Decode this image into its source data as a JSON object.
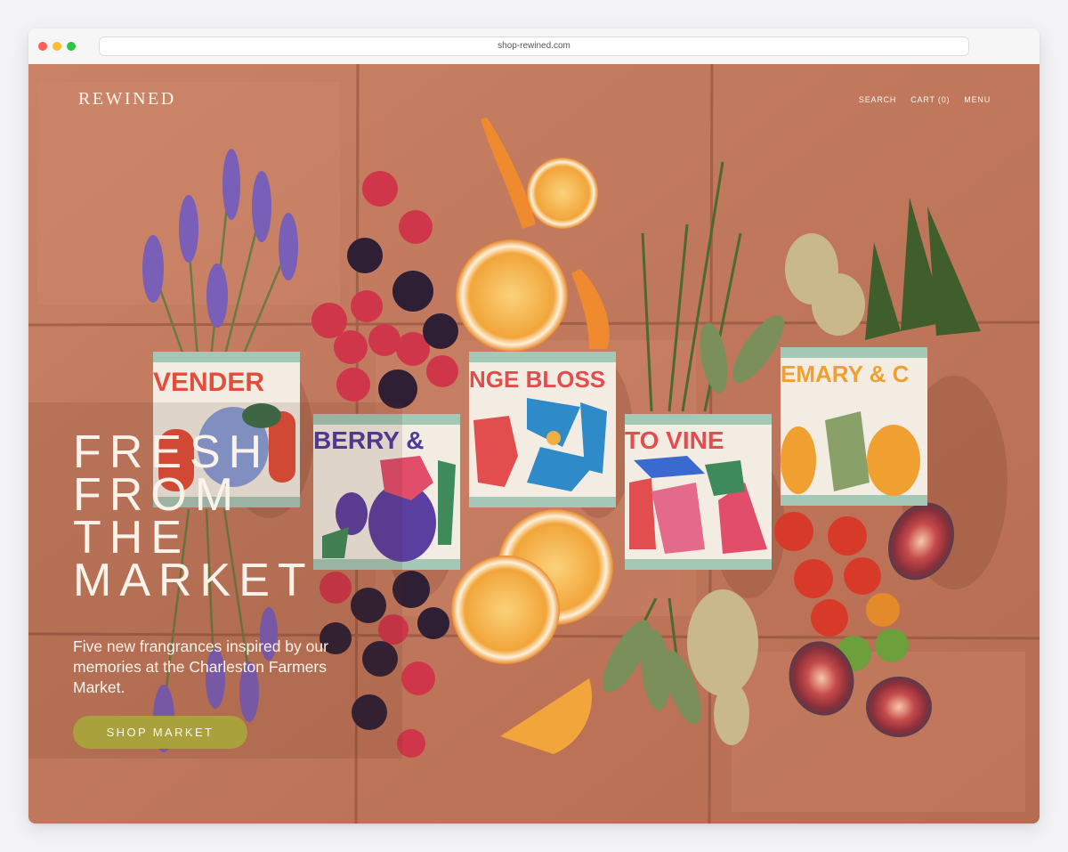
{
  "browser": {
    "url": "shop-rewined.com"
  },
  "header": {
    "logo": "REWINED",
    "nav": {
      "search": "SEARCH",
      "cart": "CART (0)",
      "menu": "MENU"
    }
  },
  "hero": {
    "headline": [
      "FRESH",
      "FROM",
      "THE",
      "MARKET"
    ],
    "subtext": "Five new frangrances inspired by our memories at the Charleston Farmers Market.",
    "cta_label": "SHOP MARKET",
    "can_labels": [
      "VENDER",
      "BERRY &",
      "NGE BLOSS",
      "TO VINE",
      "EMARY & C"
    ]
  },
  "colors": {
    "tile": "#c0775a",
    "grout": "#8a4a36",
    "cta": "#a9a23c",
    "text_light": "#fbf3ea"
  }
}
